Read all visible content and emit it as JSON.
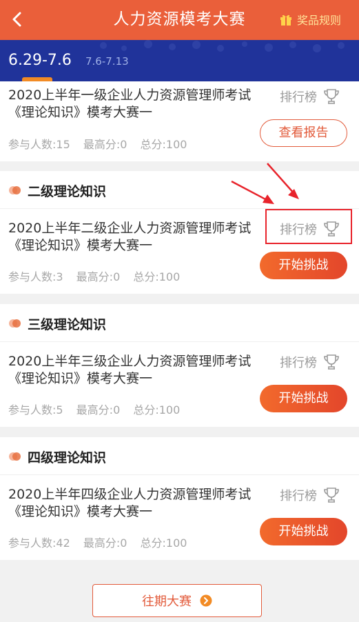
{
  "header": {
    "title": "人力资源模考大赛",
    "rules_label": "奖品规则"
  },
  "periods": [
    {
      "label": "6.29-7.6",
      "active": true
    },
    {
      "label": "7.6-7.13",
      "active": false
    }
  ],
  "partial_card": {
    "exam_title": "2020上半年一级企业人力资源管理师考试《理论知识》模考大赛一",
    "rank_label": "排行榜",
    "participants": "参与人数:15",
    "high_score": "最高分:0",
    "total_score": "总分:100",
    "button_label": "查看报告"
  },
  "sections": [
    {
      "title": "二级理论知识",
      "exam_title": "2020上半年二级企业人力资源管理师考试《理论知识》模考大赛一",
      "rank_label": "排行榜",
      "participants": "参与人数:3",
      "high_score": "最高分:0",
      "total_score": "总分:100",
      "button_label": "开始挑战"
    },
    {
      "title": "三级理论知识",
      "exam_title": "2020上半年三级企业人力资源管理师考试《理论知识》模考大赛一",
      "rank_label": "排行榜",
      "participants": "参与人数:5",
      "high_score": "最高分:0",
      "total_score": "总分:100",
      "button_label": "开始挑战"
    },
    {
      "title": "四级理论知识",
      "exam_title": "2020上半年四级企业人力资源管理师考试《理论知识》模考大赛一",
      "rank_label": "排行榜",
      "participants": "参与人数:42",
      "high_score": "最高分:0",
      "total_score": "总分:100",
      "button_label": "开始挑战"
    }
  ],
  "footer": {
    "history_label": "往期大赛"
  },
  "icons": {
    "back": "chevron-left-icon",
    "gift": "gift-icon",
    "trophy": "trophy-icon",
    "section_dot": "section-dot-icon",
    "history_arrow": "chevron-right-circle-icon"
  },
  "colors": {
    "header_bg": "#ea5f3a",
    "period_bar_bg": "#20339a",
    "accent": "#e25a3a",
    "annotation_red": "#e8232b"
  }
}
